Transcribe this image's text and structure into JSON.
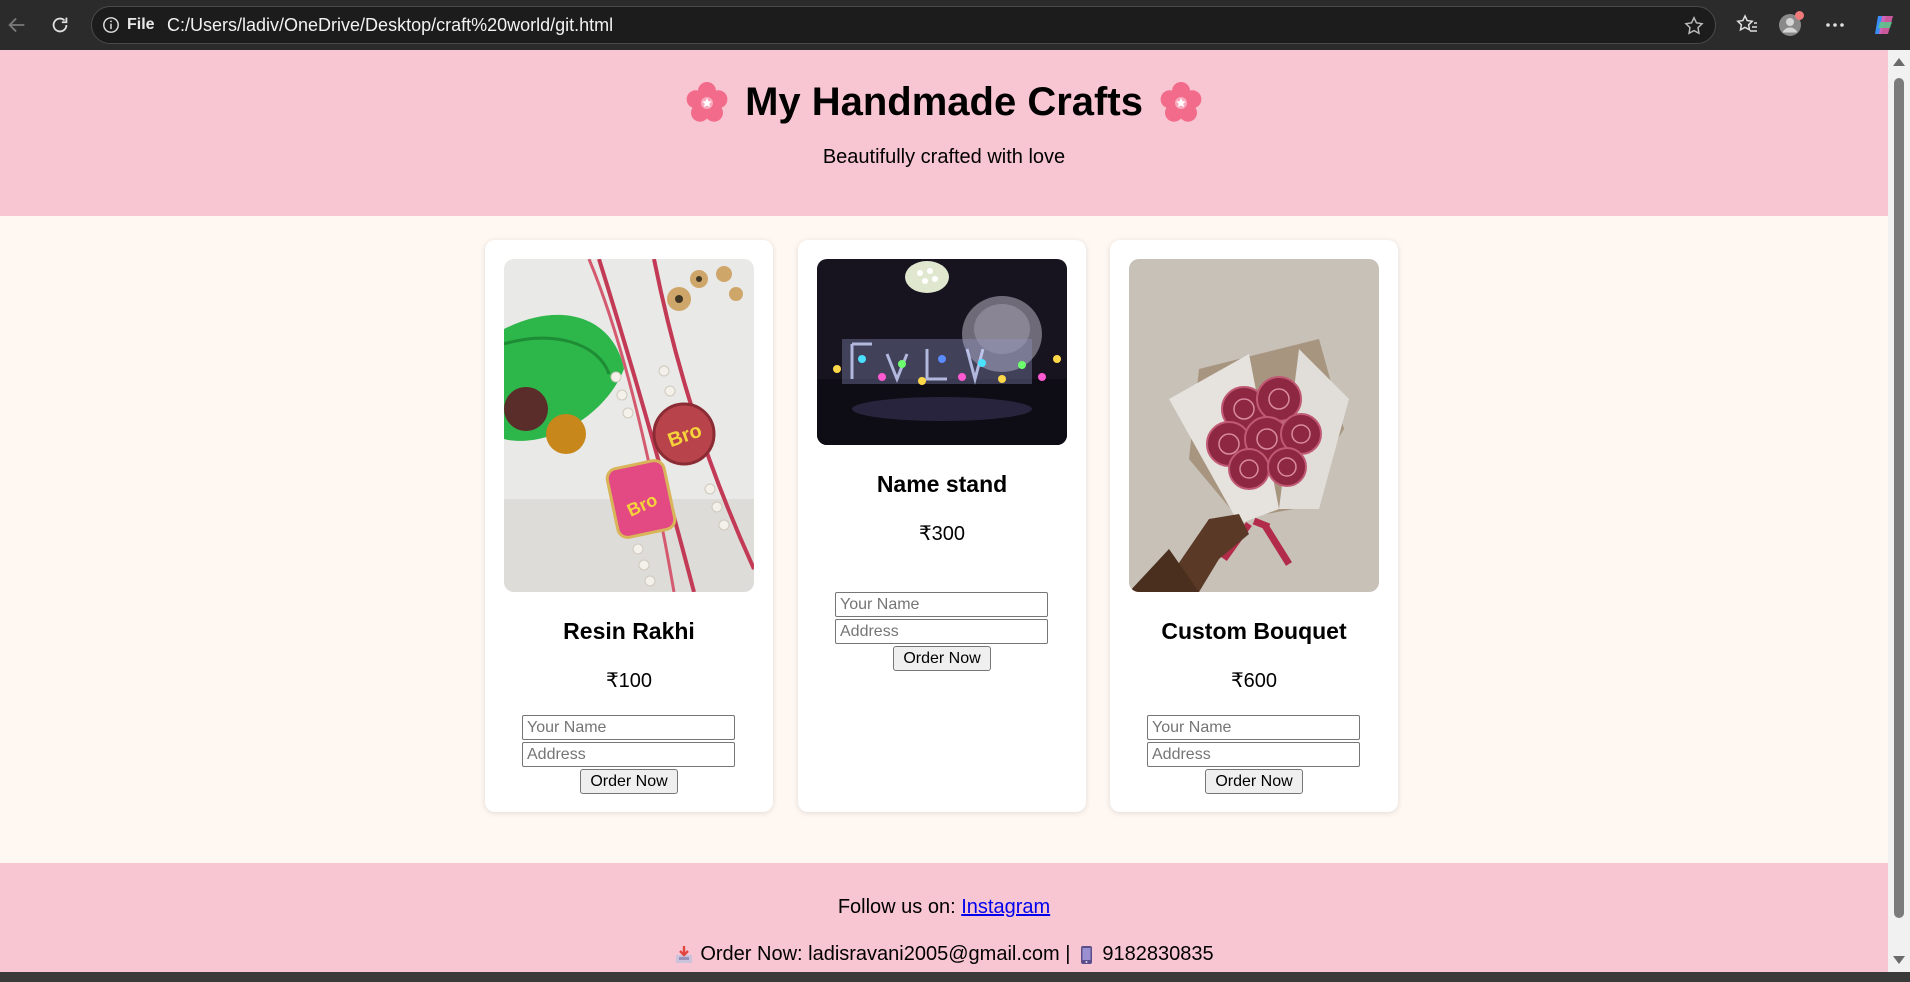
{
  "browser": {
    "file_label": "File",
    "url": "C:/Users/ladiv/OneDrive/Desktop/craft%20world/git.html",
    "icons": [
      "back-icon",
      "reload-icon",
      "info-icon",
      "star-icon",
      "favorites-icon",
      "profile-icon",
      "more-icon",
      "copilot-icon"
    ]
  },
  "header": {
    "title": "My Handmade Crafts",
    "tagline": "Beautifully crafted with love",
    "decor_icon": "cherry-blossom-icon",
    "background": "#f8c6d2"
  },
  "products": [
    {
      "name": "Resin Rakhi",
      "price": "₹100",
      "name_placeholder": "Your Name",
      "address_placeholder": "Address",
      "button": "Order Now"
    },
    {
      "name": "Name stand",
      "price": "₹300",
      "name_placeholder": "Your Name",
      "address_placeholder": "Address",
      "button": "Order Now"
    },
    {
      "name": "Custom Bouquet",
      "price": "₹600",
      "name_placeholder": "Your Name",
      "address_placeholder": "Address",
      "button": "Order Now"
    }
  ],
  "footer": {
    "follow_text": "Follow us on:",
    "instagram_link": "Instagram",
    "contact_text": "Order Now: ladisravani2005@gmail.com |",
    "phone": "9182830835",
    "mail_icon": "inbox-tray-icon",
    "phone_icon": "mobile-phone-icon"
  },
  "colors": {
    "page_background": "#fff7f1",
    "card_background": "#ffffff",
    "link": "#0000ee"
  }
}
